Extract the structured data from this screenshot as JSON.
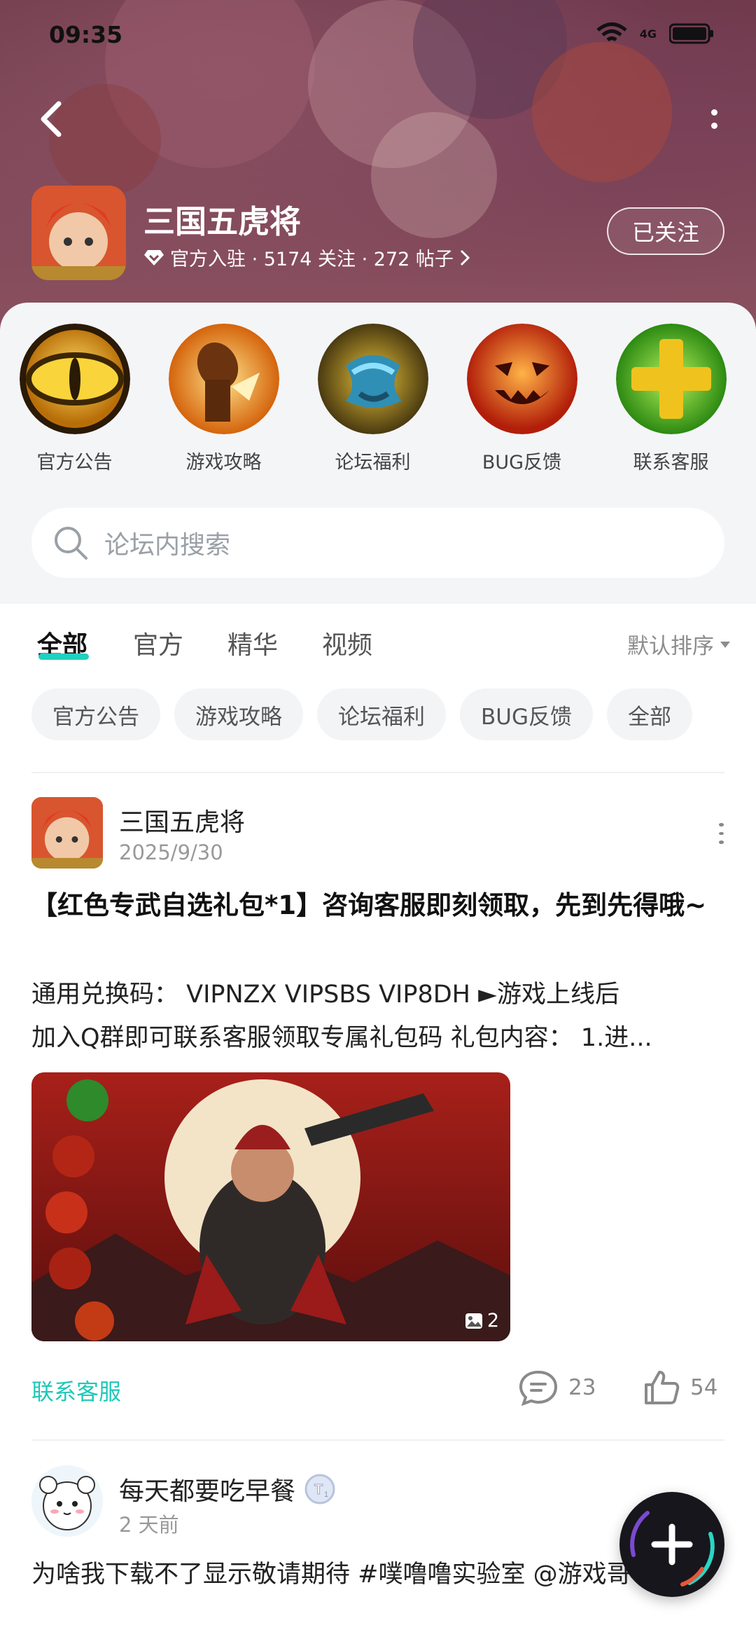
{
  "status_bar": {
    "time": "09:35",
    "network": "4G"
  },
  "forum": {
    "name": "三国五虎将",
    "meta": "官方入驻 · 5174 关注 · 272 帖子",
    "follow_label": "已关注"
  },
  "quick_entries": [
    {
      "label": "官方公告",
      "icon": "eye-icon"
    },
    {
      "label": "游戏攻略",
      "icon": "strategy-icon"
    },
    {
      "label": "论坛福利",
      "icon": "gift-icon"
    },
    {
      "label": "BUG反馈",
      "icon": "pumpkin-icon"
    },
    {
      "label": "联系客服",
      "icon": "plus-cross-icon"
    }
  ],
  "search": {
    "placeholder": "论坛内搜索"
  },
  "tabs": [
    "全部",
    "官方",
    "精华",
    "视频"
  ],
  "sort_label": "默认排序",
  "chips": [
    "官方公告",
    "游戏攻略",
    "论坛福利",
    "BUG反馈",
    "全部"
  ],
  "posts": [
    {
      "author": "三国五虎将",
      "date": "2025/9/30",
      "title": "【红色专武自选礼包*1】咨询客服即刻领取，先到先得哦~",
      "body_line1": "通用兑换码：  VIPNZX  VIPSBS  VIP8DH  ►游戏上线后",
      "body_line2": "加入Q群即可联系客服领取专属礼包码 礼包内容： 1.进...",
      "image_count": "2",
      "tag": "联系客服",
      "comments": "23",
      "likes": "54"
    },
    {
      "author": "每天都要吃早餐",
      "level_badge": "T1",
      "date": "2 天前",
      "body": "为啥我下载不了显示敬请期待 #噗噜噜实验室 @游戏哥"
    }
  ],
  "colors": {
    "accent": "#1fd1c0",
    "header_bg": "#7d4656",
    "card_bg": "#f4f5f7"
  }
}
